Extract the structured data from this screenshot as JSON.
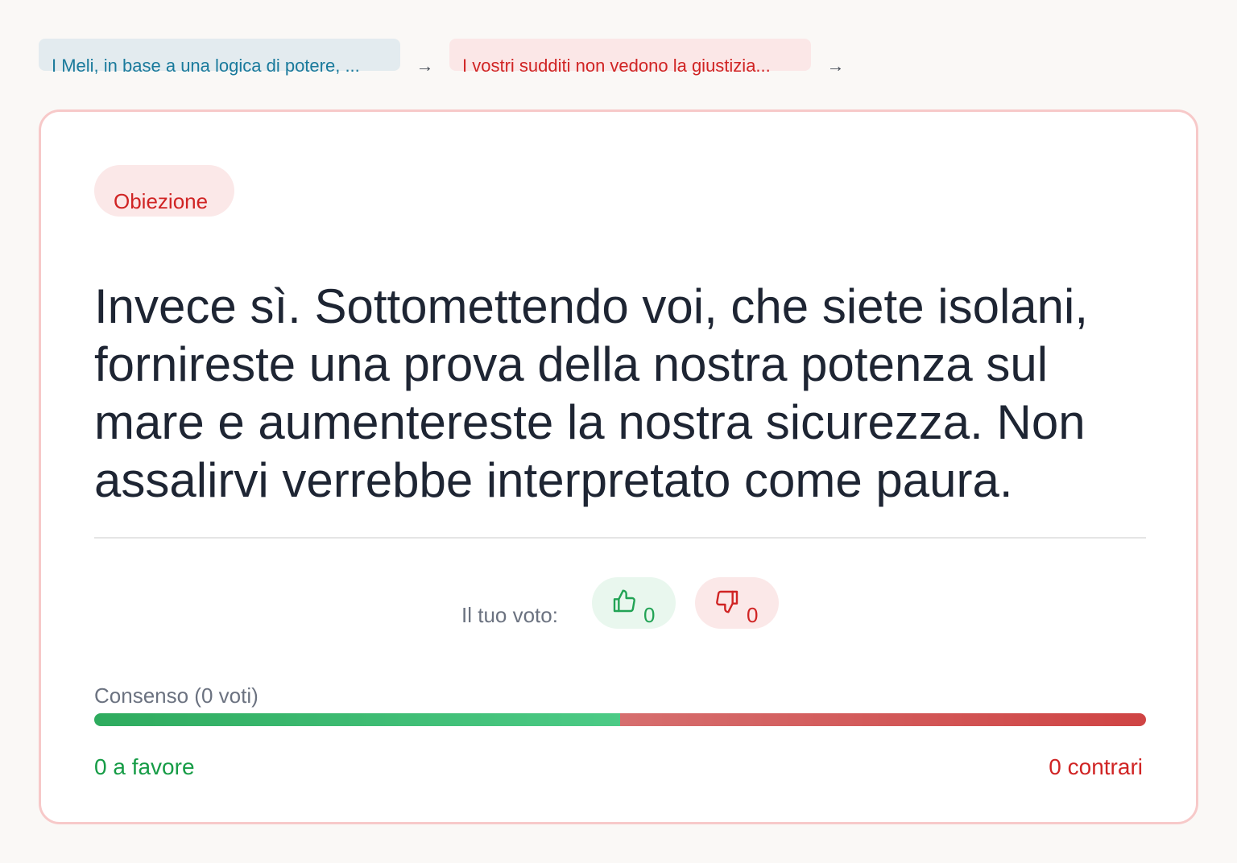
{
  "breadcrumb": {
    "items": [
      {
        "label": "I Meli, in base a una logica di potere, ...",
        "tone": "blue"
      },
      {
        "label": "I vostri sudditi non vedono la giustizia...",
        "tone": "red"
      }
    ],
    "separator": "→"
  },
  "card": {
    "tag": "Obiezione",
    "statement": "Invece sì. Sottomettendo voi, che siete isolani, fornireste una prova della nostra potenza sul mare e aumentereste la nostra sicurezza. Non assalirvi verrebbe interpretato come paura.",
    "vote": {
      "label": "Il tuo voto:",
      "up_count": "0",
      "down_count": "0",
      "up_icon": "thumbs-up-icon",
      "down_icon": "thumbs-down-icon"
    },
    "consensus": {
      "label": "Consenso (0 voti)",
      "pro_fraction": 0.5,
      "pro_text": "0 a favore",
      "con_text": "0 contrari"
    }
  },
  "colors": {
    "pro": "#22a355",
    "con": "#d02424",
    "card_border": "#f7c9c9",
    "background": "#faf8f6"
  }
}
